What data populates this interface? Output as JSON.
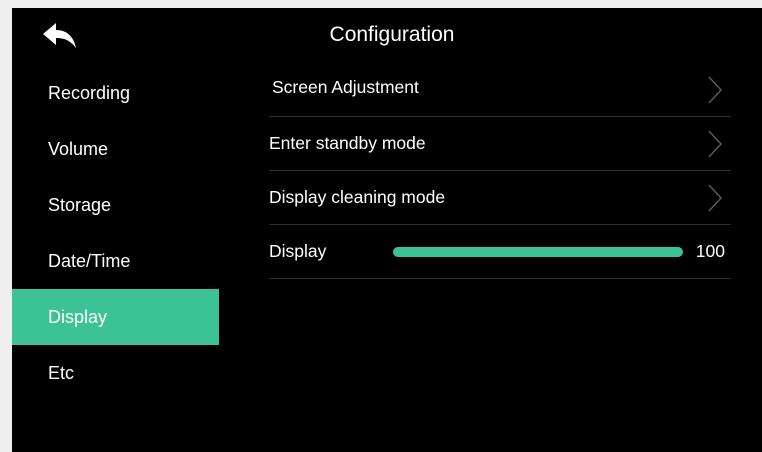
{
  "header": {
    "title": "Configuration",
    "back_icon": "back-arrow-icon"
  },
  "sidebar": {
    "items": [
      {
        "label": "Recording"
      },
      {
        "label": "Volume"
      },
      {
        "label": "Storage"
      },
      {
        "label": "Date/Time"
      },
      {
        "label": "Display",
        "active": true
      },
      {
        "label": "Etc"
      }
    ]
  },
  "content": {
    "rows": [
      {
        "label": "Screen Adjustment",
        "icon": "chevron-right-icon"
      },
      {
        "label": "Enter standby mode",
        "icon": "chevron-right-icon"
      },
      {
        "label": "Display cleaning mode",
        "icon": "chevron-right-icon"
      }
    ],
    "display": {
      "label": "Display",
      "value": "100",
      "level_percent": 100
    }
  },
  "colors": {
    "accent": "#3cc395",
    "background": "#000000",
    "text": "#ffffff",
    "divider": "#2e2e2e"
  }
}
